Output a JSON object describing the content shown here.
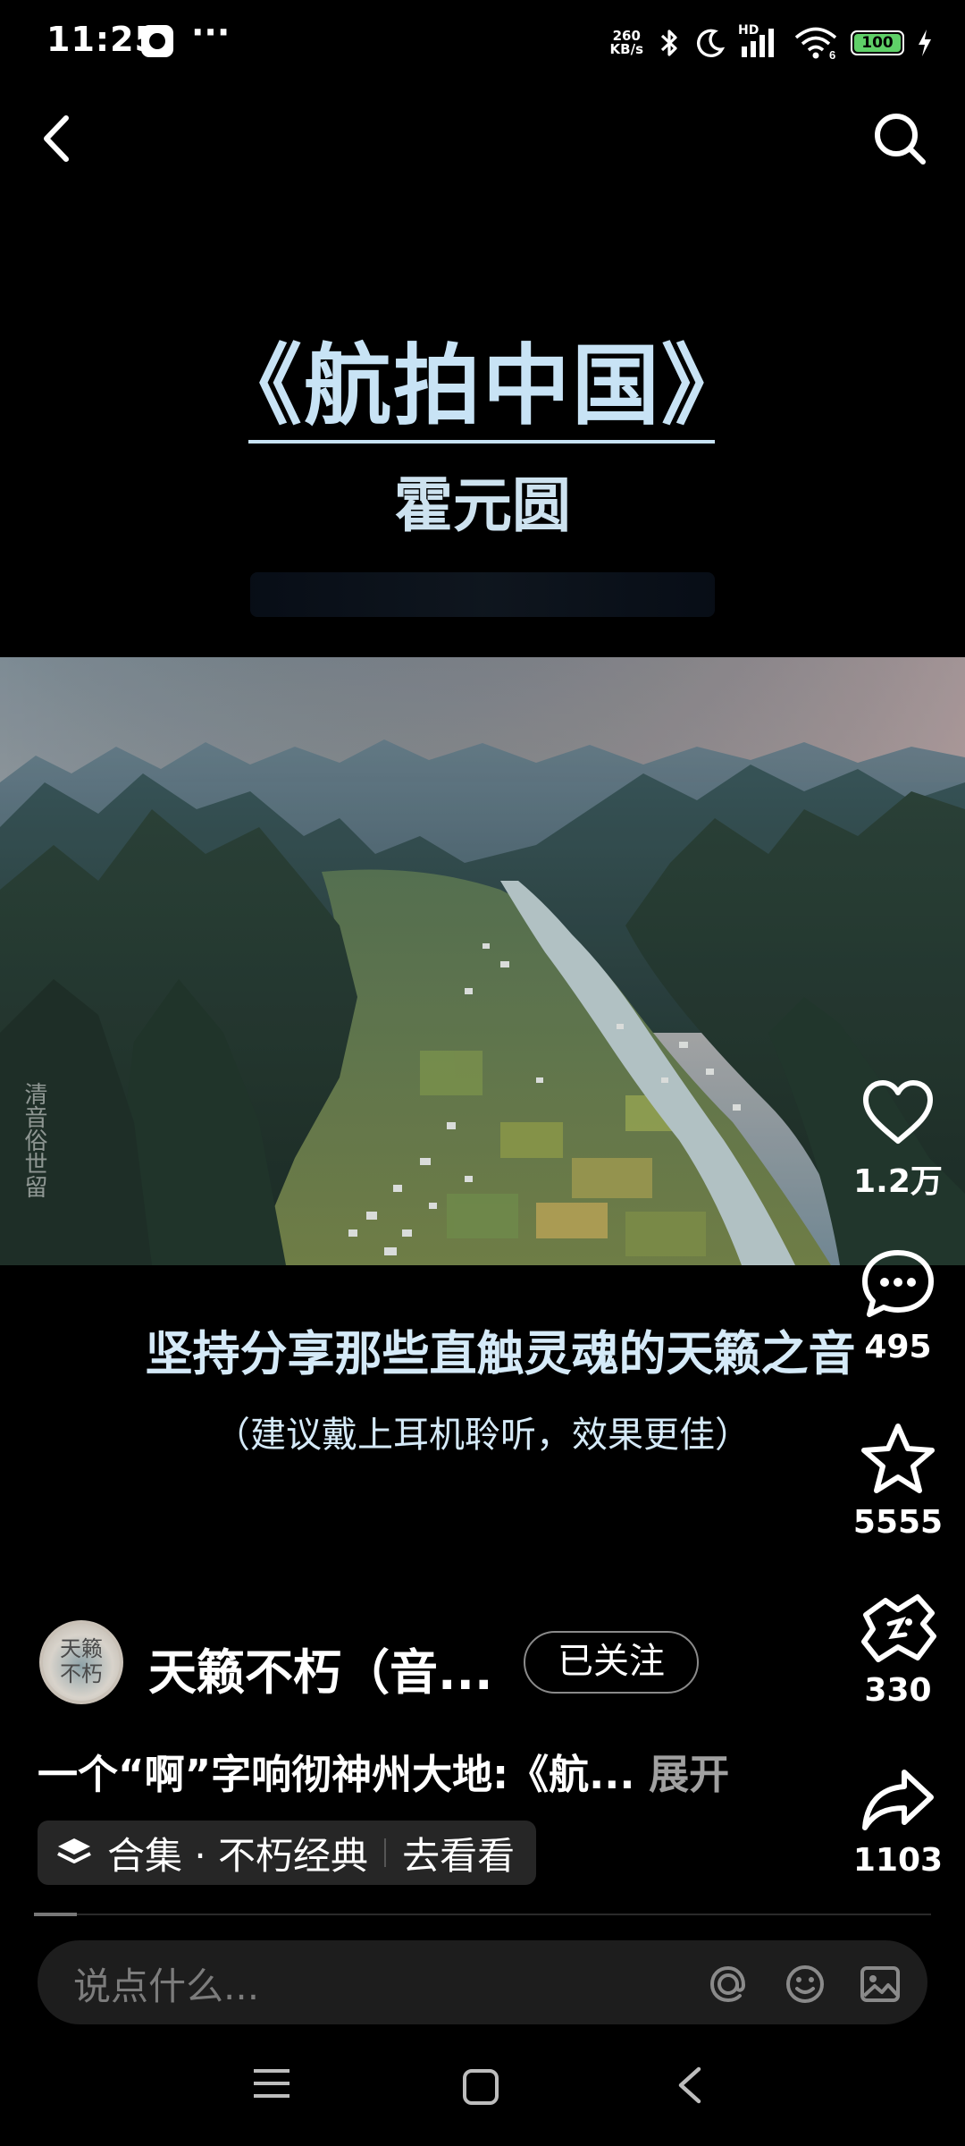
{
  "status_bar": {
    "time": "11:25",
    "net_speed_value": "260",
    "net_speed_unit": "KB/s",
    "network_badge": "HD",
    "battery": "100"
  },
  "video": {
    "title": "《航拍中国》",
    "artist": "霍元圆",
    "watermark": "清音俗世留",
    "caption_main": "坚持分享那些直触灵魂的天籁之音",
    "caption_sub": "（建议戴上耳机聆听，效果更佳）"
  },
  "actions": {
    "likes": "1.2万",
    "comments": "495",
    "favorites": "5555",
    "gifts": "330",
    "shares": "1103"
  },
  "author": {
    "avatar_text_line1": "天籁",
    "avatar_text_line2": "不朽",
    "name": "天籁不朽（音...",
    "follow_label": "已关注"
  },
  "description": {
    "text": "一个“啊”字响彻神州大地:《航...",
    "expand_label": "展开"
  },
  "collection": {
    "label": "合集 · 不朽经典",
    "action": "去看看"
  },
  "comment": {
    "placeholder": "说点什么..."
  },
  "icons": [
    "back-icon",
    "search-icon",
    "heart-icon",
    "comment-icon",
    "star-icon",
    "gift-icon",
    "share-icon",
    "at-icon",
    "emoji-icon",
    "image-icon",
    "layers-icon",
    "menu-icon",
    "home-icon",
    "nav-back-icon"
  ]
}
